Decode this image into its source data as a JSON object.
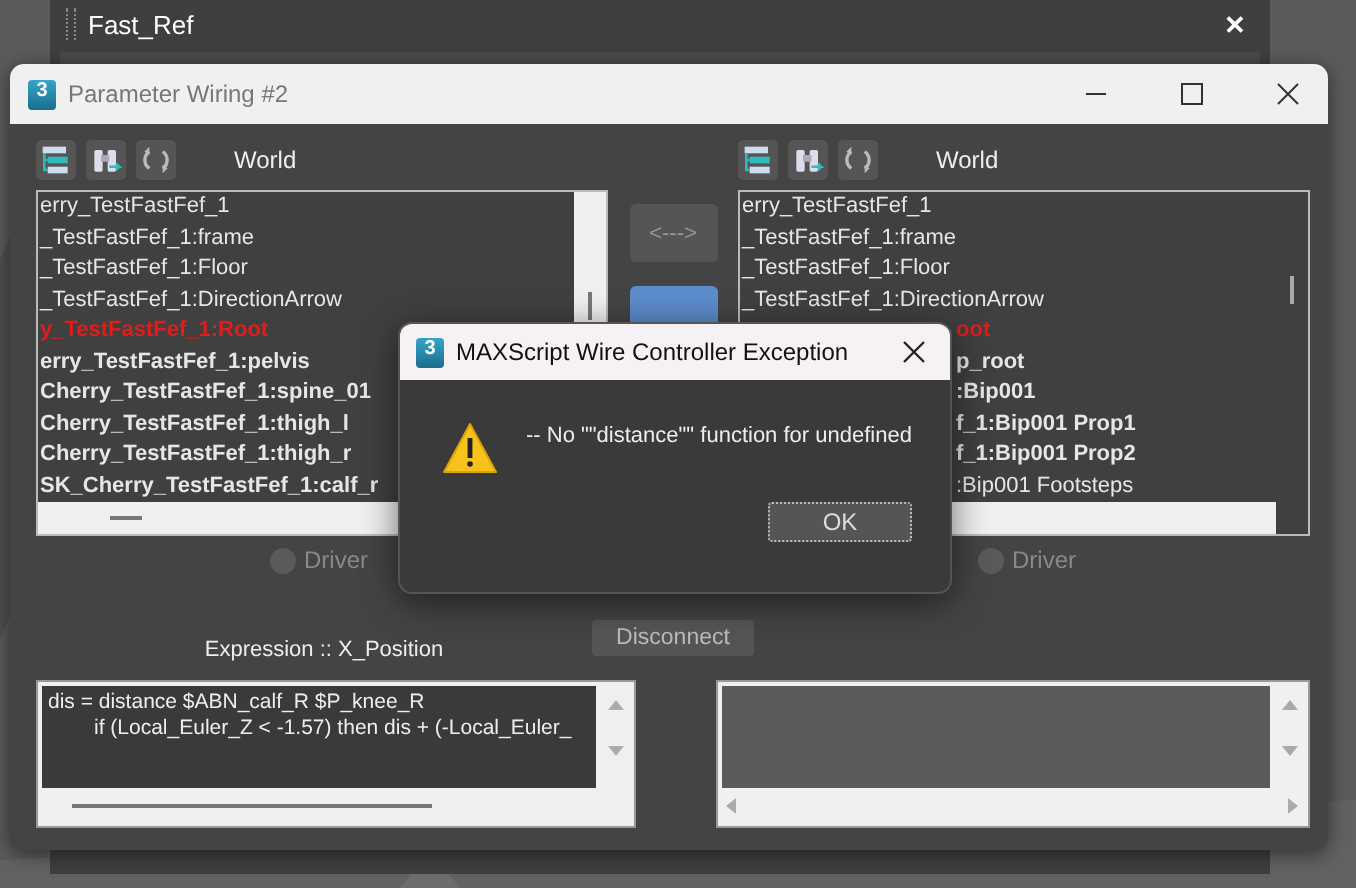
{
  "fast_ref_panel": {
    "title": "Fast_Ref",
    "close": "✕"
  },
  "window": {
    "title": "Parameter Wiring #2",
    "icon_label": "3"
  },
  "panes": [
    {
      "space": "World",
      "driver": {
        "label": "Driver",
        "selected": false,
        "disabled": true
      },
      "items": [
        {
          "kind": "full",
          "text": "erry_TestFastFef_1",
          "bold": false,
          "highlighted": false
        },
        {
          "kind": "full",
          "text": "_TestFastFef_1:frame",
          "bold": false,
          "highlighted": false
        },
        {
          "kind": "full",
          "text": "_TestFastFef_1:Floor",
          "bold": false,
          "highlighted": false
        },
        {
          "kind": "full",
          "text": "_TestFastFef_1:DirectionArrow",
          "bold": false,
          "highlighted": false
        },
        {
          "kind": "full",
          "text": "y_TestFastFef_1:Root",
          "bold": true,
          "highlighted": true
        },
        {
          "kind": "full",
          "text": "erry_TestFastFef_1:pelvis",
          "bold": true,
          "highlighted": false
        },
        {
          "kind": "full",
          "text": "Cherry_TestFastFef_1:spine_01",
          "bold": true,
          "highlighted": false
        },
        {
          "kind": "full",
          "text": "Cherry_TestFastFef_1:thigh_l",
          "bold": true,
          "highlighted": false
        },
        {
          "kind": "full",
          "text": "Cherry_TestFastFef_1:thigh_r",
          "bold": true,
          "highlighted": false
        },
        {
          "kind": "full",
          "text": "SK_Cherry_TestFastFef_1:calf_r",
          "bold": true,
          "highlighted": false
        }
      ]
    },
    {
      "space": "World",
      "driver": {
        "label": "Driver",
        "selected": false,
        "disabled": true
      },
      "items": [
        {
          "kind": "full",
          "text": "erry_TestFastFef_1",
          "bold": false,
          "highlighted": false
        },
        {
          "kind": "full",
          "text": "_TestFastFef_1:frame",
          "bold": false,
          "highlighted": false
        },
        {
          "kind": "full",
          "text": "_TestFastFef_1:Floor",
          "bold": false,
          "highlighted": false
        },
        {
          "kind": "full",
          "text": "_TestFastFef_1:DirectionArrow",
          "bold": false,
          "highlighted": false
        },
        {
          "kind": "clipped",
          "text": "oot",
          "bold": true,
          "highlighted": true
        },
        {
          "kind": "clipped",
          "text": "p_root",
          "bold": true,
          "highlighted": false
        },
        {
          "kind": "clipped",
          "text": ":Bip001",
          "bold": true,
          "highlighted": false
        },
        {
          "kind": "clipped",
          "text": "f_1:Bip001 Prop1",
          "bold": true,
          "highlighted": false
        },
        {
          "kind": "clipped",
          "text": "f_1:Bip001 Prop2",
          "bold": true,
          "highlighted": false
        },
        {
          "kind": "clipped",
          "text": ":Bip001 Footsteps",
          "bold": false,
          "highlighted": false
        }
      ]
    }
  ],
  "middle": {
    "arrow_button": "<--->",
    "disconnect": "Disconnect"
  },
  "expression": {
    "label": "Expression :: X_Position",
    "lines": [
      {
        "text": "dis = distance $ABN_calf_R $P_knee_R",
        "indented": false
      },
      {
        "text": "if (Local_Euler_Z < -1.57) then dis + (-Local_Euler_",
        "indented": true
      }
    ]
  },
  "dialog": {
    "title": "MAXScript Wire Controller Exception",
    "icon_label": "3",
    "message": "-- No \"\"distance\"\" function for undefined",
    "ok": "OK"
  }
}
